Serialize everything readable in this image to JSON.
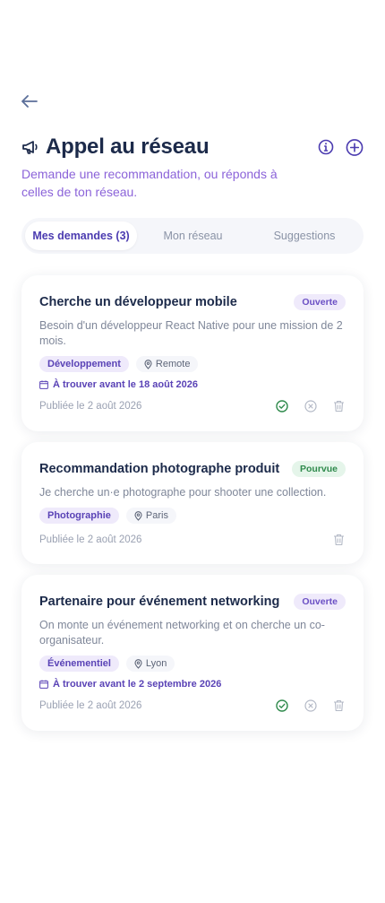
{
  "header": {
    "title": "Appel au réseau",
    "subtitle": "Demande une recommandation, ou réponds à celles de ton réseau.",
    "back_icon": "arrow-left-icon",
    "info_icon": "info-circle-icon",
    "add_icon": "plus-circle-icon"
  },
  "tabs": [
    {
      "label": "Mes demandes (3)",
      "active": true
    },
    {
      "label": "Mon réseau",
      "active": false
    },
    {
      "label": "Suggestions",
      "active": false
    }
  ],
  "requests": [
    {
      "title": "Cherche un développeur mobile",
      "status": "Ouverte",
      "description": "Besoin d'un développeur React Native pour une mission de 2 mois.",
      "category": "Développement",
      "location": "Remote",
      "deadline": "À trouver avant le 18 août 2026",
      "published": "Publiée le 2 août 2026"
    },
    {
      "title": "Recommandation photographe produit",
      "status": "Pourvue",
      "description": "Je cherche un·e photographe pour shooter une collection.",
      "category": "Photographie",
      "location": "Paris",
      "published": "Publiée le 2 août 2026"
    },
    {
      "title": "Partenaire pour événement networking",
      "status": "Ouverte",
      "description": "On monte un événement networking et on cherche un co-organisateur.",
      "category": "Événementiel",
      "location": "Lyon",
      "deadline": "À trouver avant le 2 septembre 2026",
      "published": "Publiée le 2 août 2026"
    }
  ],
  "colors": {
    "accent": "#5a43b6",
    "subtitle": "#8b63d9",
    "open_badge_bg": "#efeafb",
    "filled_badge_bg": "#e5f5ea",
    "check": "#2f8a4c"
  }
}
